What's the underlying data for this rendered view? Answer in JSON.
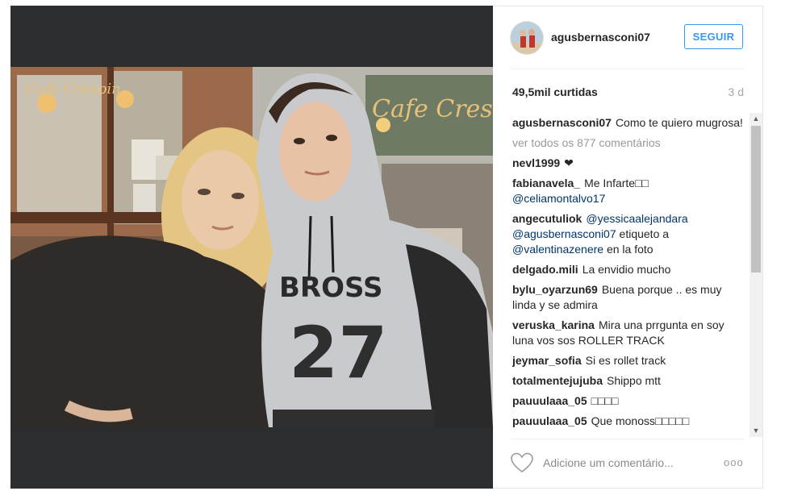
{
  "post": {
    "username": "agusbernasconi07",
    "follow_label": "SEGUIR",
    "likes": "49,5mil curtidas",
    "time_ago": "3 d",
    "caption": "Como te quiero mugrosa!",
    "view_all": "ver todos os 877 comentários"
  },
  "photo": {
    "cafe_sign_left": "Cafe Crespin",
    "cafe_sign_right": "Cafe Crespi",
    "hoodie_text": "BROSS",
    "hoodie_number": "27"
  },
  "comments": [
    {
      "user": "nevl1999",
      "text": "❤"
    },
    {
      "user": "fabianavela_",
      "text": "Me Infarte□□",
      "mention": "@celiamontalvo17"
    },
    {
      "user": "angecutuliok",
      "mention": "@yessicaalejandara",
      "mention2": "@agusbernasconi07",
      "text": "etiqueto a",
      "mention3": "@valentinazenere",
      "text2": "en la foto"
    },
    {
      "user": "delgado.mili",
      "text": "La envidio mucho"
    },
    {
      "user": "bylu_oyarzun69",
      "text": "Buena porque .. es muy linda y se admira"
    },
    {
      "user": "veruska_karina",
      "text": "Mira una prrgunta en soy luna vos sos ROLLER TRACK"
    },
    {
      "user": "jeymar_sofia",
      "text": "Si es rollet track"
    },
    {
      "user": "totalmentejujuba",
      "text": "Shippo mtt"
    },
    {
      "user": "pauuulaaa_05",
      "text": "□□□□"
    },
    {
      "user": "pauuulaaa_05",
      "text": "Que monoss□□□□□"
    }
  ],
  "footer": {
    "comment_placeholder": "Adicione um comentário...",
    "more_label": "ooo"
  },
  "icons": {
    "heart": "heart-icon",
    "more": "more-options-icon",
    "scroll_up": "scroll-up-icon",
    "scroll_down": "scroll-down-icon"
  },
  "colors": {
    "accent": "#3897f0",
    "media_bg": "#2c2d2f",
    "mention": "#003569"
  }
}
